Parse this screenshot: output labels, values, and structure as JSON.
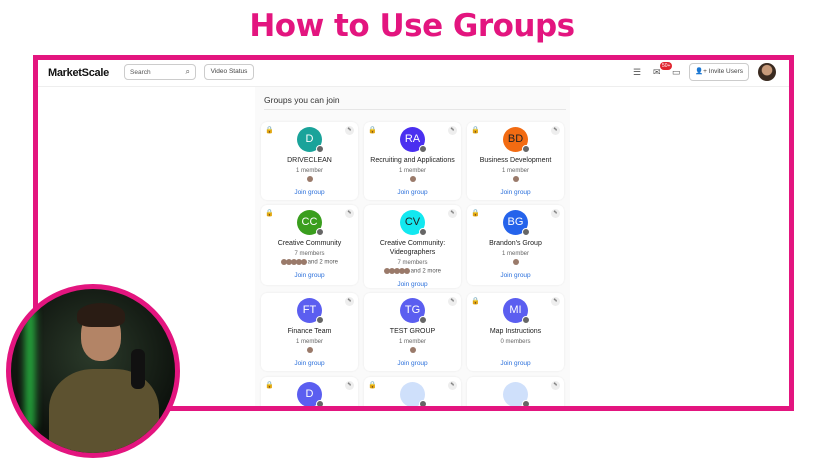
{
  "title": "How to Use Groups",
  "header": {
    "logo": "MarketScale",
    "search_placeholder": "Search",
    "video_status": "Video Status",
    "notif_badge": "50+",
    "invite": "Invite Users"
  },
  "section_title": "Groups you can join",
  "join_label": "Join group",
  "colors": {
    "accent": "#e3157f",
    "link": "#2a6fdb"
  },
  "groups": [
    {
      "initials": "D",
      "name": "DRIVECLEAN",
      "count": "1 member",
      "members": 1,
      "more": "",
      "locked": true,
      "color": "#1aa39a"
    },
    {
      "initials": "RA",
      "name": "Recruiting and Applications",
      "count": "1 member",
      "members": 1,
      "more": "",
      "locked": true,
      "color": "#4a2ff0"
    },
    {
      "initials": "BD",
      "name": "Business Development",
      "count": "1 member",
      "members": 1,
      "more": "",
      "locked": true,
      "color": "#f26b12",
      "dark": true
    },
    {
      "initials": "CC",
      "name": "Creative Community",
      "count": "7 members",
      "members": 5,
      "more": "and 2 more",
      "locked": true,
      "color": "#3a9e1e"
    },
    {
      "initials": "CV",
      "name": "Creative Community: Videographers",
      "count": "7 members",
      "members": 5,
      "more": "and 2 more",
      "locked": false,
      "color": "#12e8f0",
      "dark": true
    },
    {
      "initials": "BG",
      "name": "Brandon's Group",
      "count": "1 member",
      "members": 1,
      "more": "",
      "locked": true,
      "color": "#2563eb"
    },
    {
      "initials": "FT",
      "name": "Finance Team",
      "count": "1 member",
      "members": 1,
      "more": "",
      "locked": false,
      "color": "#5b5ef0"
    },
    {
      "initials": "TG",
      "name": "TEST GROUP",
      "count": "1 member",
      "members": 1,
      "more": "",
      "locked": false,
      "color": "#5b5ef0"
    },
    {
      "initials": "MI",
      "name": "Map Instructions",
      "count": "0 members",
      "members": 0,
      "more": "",
      "locked": true,
      "color": "#5b5ef0"
    },
    {
      "initials": "D",
      "name": "",
      "count": "",
      "members": 0,
      "more": "",
      "locked": true,
      "color": "#5b5ef0"
    },
    {
      "initials": "",
      "name": "",
      "count": "",
      "members": 0,
      "more": "",
      "locked": true,
      "color": "#cfe0fb"
    },
    {
      "initials": "",
      "name": "",
      "count": "",
      "members": 0,
      "more": "",
      "locked": false,
      "color": "#cfe0fb"
    }
  ]
}
